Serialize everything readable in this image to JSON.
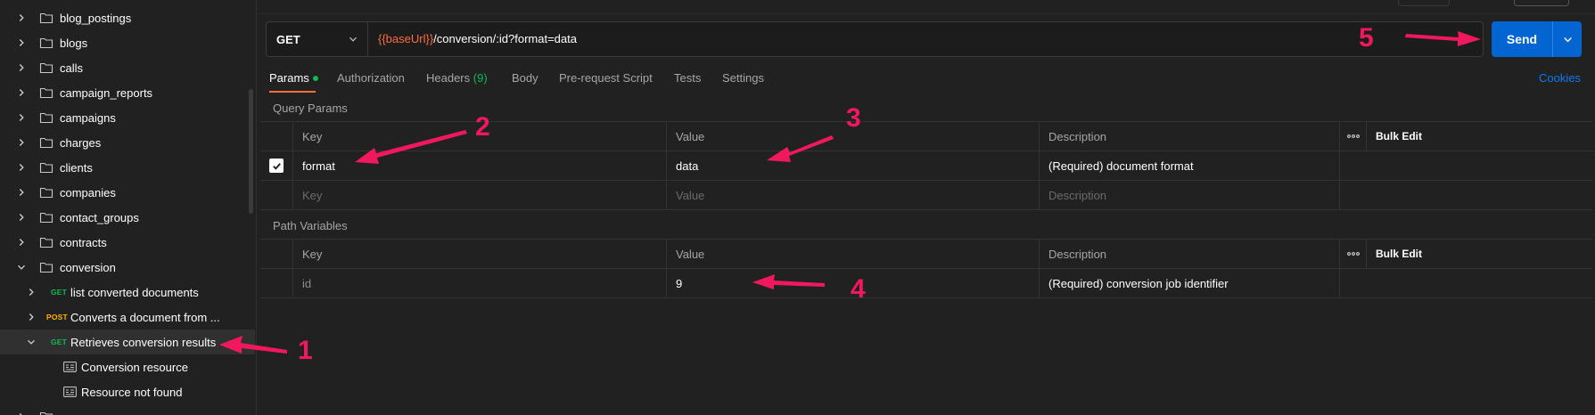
{
  "sidebar": {
    "folders": [
      {
        "label": "blog_postings"
      },
      {
        "label": "blogs"
      },
      {
        "label": "calls"
      },
      {
        "label": "campaign_reports"
      },
      {
        "label": "campaigns"
      },
      {
        "label": "charges"
      },
      {
        "label": "clients"
      },
      {
        "label": "companies"
      },
      {
        "label": "contact_groups"
      },
      {
        "label": "contracts"
      },
      {
        "label": "conversion"
      }
    ],
    "requests": [
      {
        "method": "GET",
        "label": "list converted documents"
      },
      {
        "method": "POST",
        "label": "Converts a document from ..."
      },
      {
        "method": "GET",
        "label": "Retrieves conversion results"
      }
    ],
    "examples": [
      {
        "label": "Conversion resource"
      },
      {
        "label": "Resource not found"
      }
    ],
    "colors": {
      "get": "#0cbb52",
      "post": "#ffb400"
    }
  },
  "request": {
    "method": "GET",
    "url_variable": "{{baseUrl}}",
    "url_path": "/conversion/:id?format=data",
    "send_label": "Send"
  },
  "tabs": {
    "params": "Params",
    "authorization": "Authorization",
    "headers": "Headers",
    "headers_count": "(9)",
    "body": "Body",
    "pre_request": "Pre-request Script",
    "tests": "Tests",
    "settings": "Settings",
    "cookies": "Cookies"
  },
  "query_params": {
    "title": "Query Params",
    "columns": {
      "key": "Key",
      "value": "Value",
      "description": "Description",
      "bulk_edit": "Bulk Edit"
    },
    "rows": [
      {
        "key": "format",
        "value": "data",
        "description": "(Required) document format",
        "checked": true
      }
    ],
    "placeholders": {
      "key": "Key",
      "value": "Value",
      "description": "Description"
    }
  },
  "path_variables": {
    "title": "Path Variables",
    "columns": {
      "key": "Key",
      "value": "Value",
      "description": "Description",
      "bulk_edit": "Bulk Edit"
    },
    "rows": [
      {
        "key": "id",
        "value": "9",
        "description": "(Required) conversion job identifier"
      }
    ]
  },
  "annotations": [
    "1",
    "2",
    "3",
    "4",
    "5"
  ],
  "colors": {
    "accent": "#ff6c37",
    "send": "#0265d2",
    "annotation": "#f2185d",
    "link": "#097bed"
  }
}
